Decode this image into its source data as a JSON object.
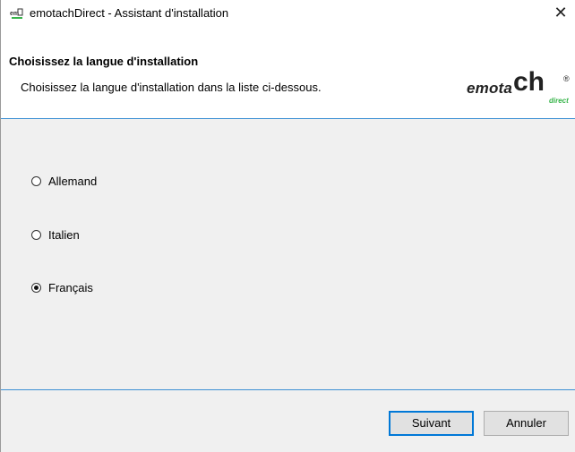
{
  "window": {
    "title": "emotachDirect - Assistant d'installation",
    "close_glyph": "✕",
    "icon": "emotach-app-icon"
  },
  "header": {
    "heading": "Choisissez la langue d'installation",
    "subheading": "Choisissez la langue d'installation dans la liste ci-dessous.",
    "logo": {
      "part1": "emota",
      "part2": "ch",
      "reg": "®",
      "direct": "direct",
      "direct_color": "#37b44a"
    }
  },
  "languages": {
    "options": [
      {
        "label": "Allemand",
        "selected": false
      },
      {
        "label": "Italien",
        "selected": false
      },
      {
        "label": "Français",
        "selected": true
      }
    ]
  },
  "footer": {
    "next_label": "Suivant",
    "cancel_label": "Annuler"
  },
  "colors": {
    "accent": "#3c8fd3",
    "button_border_focus": "#0078d7"
  }
}
